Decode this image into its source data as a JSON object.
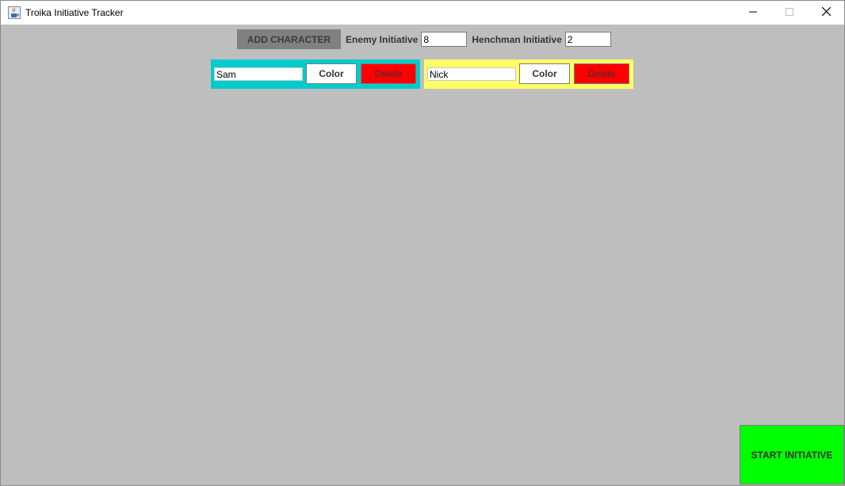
{
  "window": {
    "title": "Troika Initiative Tracker"
  },
  "toolbar": {
    "add_label": "ADD CHARACTER",
    "enemy_label": "Enemy Initiative",
    "enemy_value": "8",
    "henchman_label": "Henchman Initiative",
    "henchman_value": "2"
  },
  "characters": [
    {
      "name": "Sam",
      "color": "#00cccc",
      "color_label": "Color",
      "delete_label": "Delete"
    },
    {
      "name": "Nick",
      "color": "#ffff66",
      "color_label": "Color",
      "delete_label": "Delete"
    }
  ],
  "start": {
    "label": "START INITIATIVE",
    "color": "#00ff00"
  },
  "colors": {
    "background": "#bebebe",
    "add_button": "#808080",
    "delete_button": "#ff0000"
  },
  "icons": {
    "app": "java-cup-icon",
    "minimize": "minimize-icon",
    "maximize": "maximize-icon",
    "close": "close-icon"
  }
}
